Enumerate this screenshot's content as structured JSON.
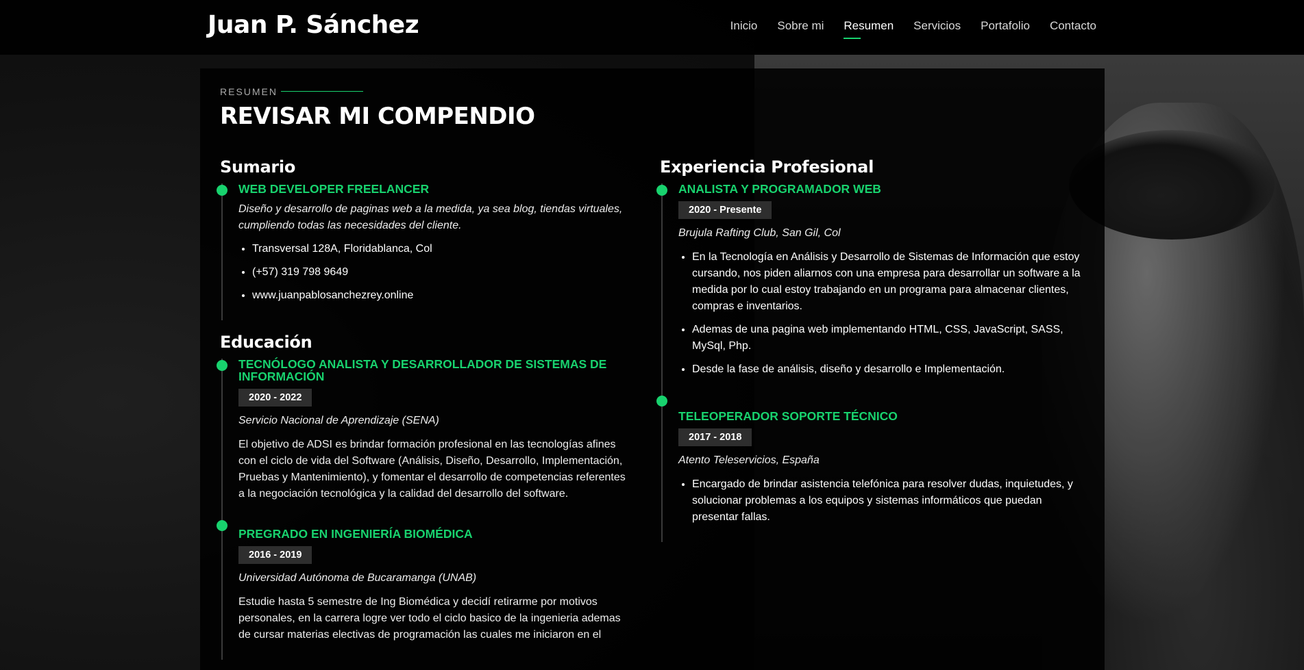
{
  "header": {
    "logo": "Juan P. Sánchez",
    "nav": [
      "Inicio",
      "Sobre mi",
      "Resumen",
      "Servicios",
      "Portafolio",
      "Contacto"
    ],
    "active": "Resumen"
  },
  "section": {
    "label": "RESUMEN",
    "title": "REVISAR MI COMPENDIO"
  },
  "sumario": {
    "heading": "Sumario",
    "title": "WEB DEVELOPER FREELANCER",
    "description": "Diseño y desarrollo de paginas web a la medida, ya sea blog, tiendas virtuales, cumpliendo todas las necesidades del cliente.",
    "contact": [
      "Transversal 128A, Floridablanca, Col",
      "(+57) 319 798 9649",
      "www.juanpablosanchezrey.online"
    ]
  },
  "educacion": {
    "heading": "Educación",
    "items": [
      {
        "title": "TECNÓLOGO ANALISTA Y DESARROLLADOR DE SISTEMAS DE INFORMACIÓN",
        "date": "2020 - 2022",
        "org": "Servicio Nacional de Aprendizaje (SENA)",
        "description": "El objetivo de ADSI es brindar formación profesional en las tecnologías afines con el ciclo de vida del Software (Análisis, Diseño, Desarrollo, Implementación, Pruebas y Mantenimiento), y fomentar el desarrollo de competencias referentes a la negociación tecnológica y la calidad del desarrollo del software."
      },
      {
        "title": "PREGRADO EN INGENIERÍA BIOMÉDICA",
        "date": "2016 - 2019",
        "org": "Universidad Autónoma de Bucaramanga (UNAB)",
        "description": "Estudie hasta 5 semestre de Ing Biomédica y decidí retirarme por motivos personales, en la carrera logre ver todo el ciclo basico de la ingenieria ademas de cursar materias electivas de programación las cuales me iniciaron en el"
      }
    ]
  },
  "experiencia": {
    "heading": "Experiencia Profesional",
    "items": [
      {
        "title": "ANALISTA Y PROGRAMADOR WEB",
        "date": "2020 - Presente",
        "org": "Brujula Rafting Club, San Gil, Col",
        "bullets": [
          "En la Tecnología en Análisis y Desarrollo de Sistemas de Información que estoy cursando, nos piden aliarnos con una empresa para desarrollar un software a la medida por lo cual estoy trabajando en un programa para almacenar clientes, compras e inventarios.",
          "Ademas de una pagina web implementando HTML, CSS, JavaScript, SASS, MySql, Php.",
          "Desde la fase de análisis, diseño y desarrollo e Implementación."
        ]
      },
      {
        "title": "TELEOPERADOR SOPORTE TÉCNICO",
        "date": "2017 - 2018",
        "org": "Atento Teleservicios, España",
        "bullets": [
          "Encargado de brindar asistencia telefónica para resolver dudas, inquietudes, y solucionar problemas a los equipos y sistemas informáticos que puedan presentar fallas."
        ]
      }
    ]
  },
  "colors": {
    "accent": "#18d26e",
    "background": "#000000",
    "date_badge": "#2e2e2e"
  }
}
